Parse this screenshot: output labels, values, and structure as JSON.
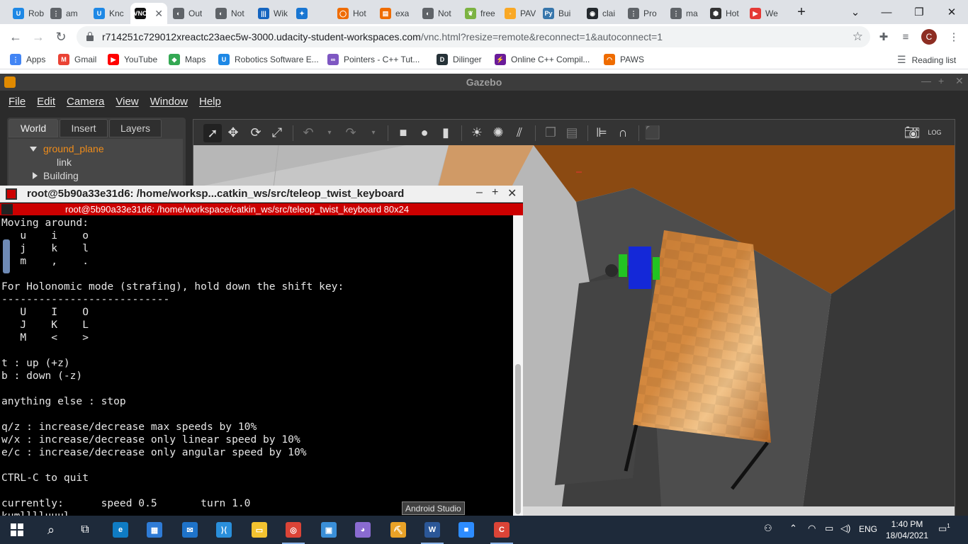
{
  "browser": {
    "tabs": [
      {
        "label": "Rob",
        "color": "#1e88e5",
        "glyph": "U"
      },
      {
        "label": "am",
        "color": "#5f6368",
        "glyph": "⋮"
      },
      {
        "label": "Knc",
        "color": "#1e88e5",
        "glyph": "U"
      },
      {
        "label": "",
        "color": "#111111",
        "glyph": "VNC",
        "active": true
      },
      {
        "label": "Out",
        "color": "#5f6368",
        "glyph": "◐"
      },
      {
        "label": "Not",
        "color": "#5f6368",
        "glyph": "◐"
      },
      {
        "label": "Wik",
        "color": "#1565c0",
        "glyph": "|||"
      },
      {
        "label": "",
        "color": "#1976d2",
        "glyph": "✦"
      },
      {
        "label": "Hot",
        "color": "#ef6c00",
        "glyph": "◯"
      },
      {
        "label": "exa",
        "color": "#ef6c00",
        "glyph": "▤"
      },
      {
        "label": "Not",
        "color": "#5f6368",
        "glyph": "◐"
      },
      {
        "label": "free",
        "color": "#7cb342",
        "glyph": "❦"
      },
      {
        "label": "PAV",
        "color": "#f9a825",
        "glyph": "◦"
      },
      {
        "label": "Bui",
        "color": "#3776ab",
        "glyph": "Py"
      },
      {
        "label": "clai",
        "color": "#24292e",
        "glyph": "◉"
      },
      {
        "label": "Pro",
        "color": "#5f6368",
        "glyph": "⋮"
      },
      {
        "label": "ma",
        "color": "#5f6368",
        "glyph": "⋮"
      },
      {
        "label": "Hot",
        "color": "#333333",
        "glyph": "⬢"
      },
      {
        "label": "We",
        "color": "#e53935",
        "glyph": "▶"
      }
    ],
    "new_tab": "+",
    "url_host": "r714251c729012xreactc23aec5w-3000.udacity-student-workspaces.com",
    "url_path": "/vnc.html?resize=remote&reconnect=1&autoconnect=1",
    "profile_initial": "C",
    "bookmarks": [
      {
        "label": "Apps",
        "color": "#4285f4",
        "glyph": "⋮"
      },
      {
        "label": "Gmail",
        "color": "#ea4335",
        "glyph": "M"
      },
      {
        "label": "YouTube",
        "color": "#ff0000",
        "glyph": "▶"
      },
      {
        "label": "Maps",
        "color": "#34a853",
        "glyph": "◆"
      },
      {
        "label": "Robotics Software E...",
        "color": "#1e88e5",
        "glyph": "U"
      },
      {
        "label": "Pointers - C++ Tut...",
        "color": "#7e57c2",
        "glyph": "∞"
      },
      {
        "label": "Dilinger",
        "color": "#263238",
        "glyph": "D"
      },
      {
        "label": "Online C++ Compil...",
        "color": "#6a1b9a",
        "glyph": "⚡"
      },
      {
        "label": "PAWS",
        "color": "#ef6c00",
        "glyph": "◠"
      }
    ],
    "reading_list": "Reading list"
  },
  "gazebo": {
    "title": "Gazebo",
    "menu": [
      "File",
      "Edit",
      "Camera",
      "View",
      "Window",
      "Help"
    ],
    "left_tabs": [
      "World",
      "Insert",
      "Layers"
    ],
    "tree": {
      "ground_plane": "ground_plane",
      "link": "link",
      "building": "Building"
    },
    "tooltip": "Android Studio"
  },
  "terminal": {
    "title": "root@5b90a33e31d6: /home/worksp...catkin_ws/src/teleop_twist_keyboard",
    "subtitle": "root@5b90a33e31d6: /home/workspace/catkin_ws/src/teleop_twist_keyboard 80x24",
    "lines": [
      "Moving around:",
      "   u    i    o",
      "   j    k    l",
      "   m    ,    .",
      "",
      "For Holonomic mode (strafing), hold down the shift key:",
      "---------------------------",
      "   U    I    O",
      "   J    K    L",
      "   M    <    >",
      "",
      "t : up (+z)",
      "b : down (-z)",
      "",
      "anything else : stop",
      "",
      "q/z : increase/decrease max speeds by 10%",
      "w/x : increase/decrease only linear speed by 10%",
      "e/c : increase/decrease only angular speed by 10%",
      "",
      "CTRL-C to quit",
      "",
      "currently:      speed 0.5       turn 1.0",
      "kumlllluuul"
    ]
  },
  "taskbar": {
    "apps": [
      {
        "name": "edge",
        "color": "#0f7cc4",
        "glyph": "e"
      },
      {
        "name": "store",
        "color": "#2e7bd6",
        "glyph": "▦"
      },
      {
        "name": "mail",
        "color": "#1f73c9",
        "glyph": "✉"
      },
      {
        "name": "vscode",
        "color": "#2a8fdb",
        "glyph": "⟩⟨"
      },
      {
        "name": "explorer",
        "color": "#f2c230",
        "glyph": "▭"
      },
      {
        "name": "chrome",
        "color": "#db4437",
        "glyph": "◎"
      },
      {
        "name": "control",
        "color": "#3a8fd8",
        "glyph": "▣"
      },
      {
        "name": "cat",
        "color": "#8a6bd1",
        "glyph": "◕"
      },
      {
        "name": "tool",
        "color": "#e9a227",
        "glyph": "⛏"
      },
      {
        "name": "word",
        "color": "#2b5797",
        "glyph": "W"
      },
      {
        "name": "zoom",
        "color": "#2d8cff",
        "glyph": "■"
      },
      {
        "name": "chrome-profile",
        "color": "#db4437",
        "glyph": "C"
      }
    ],
    "language": "ENG",
    "time": "1:40 PM",
    "date": "18/04/2021",
    "notifications": "1"
  }
}
